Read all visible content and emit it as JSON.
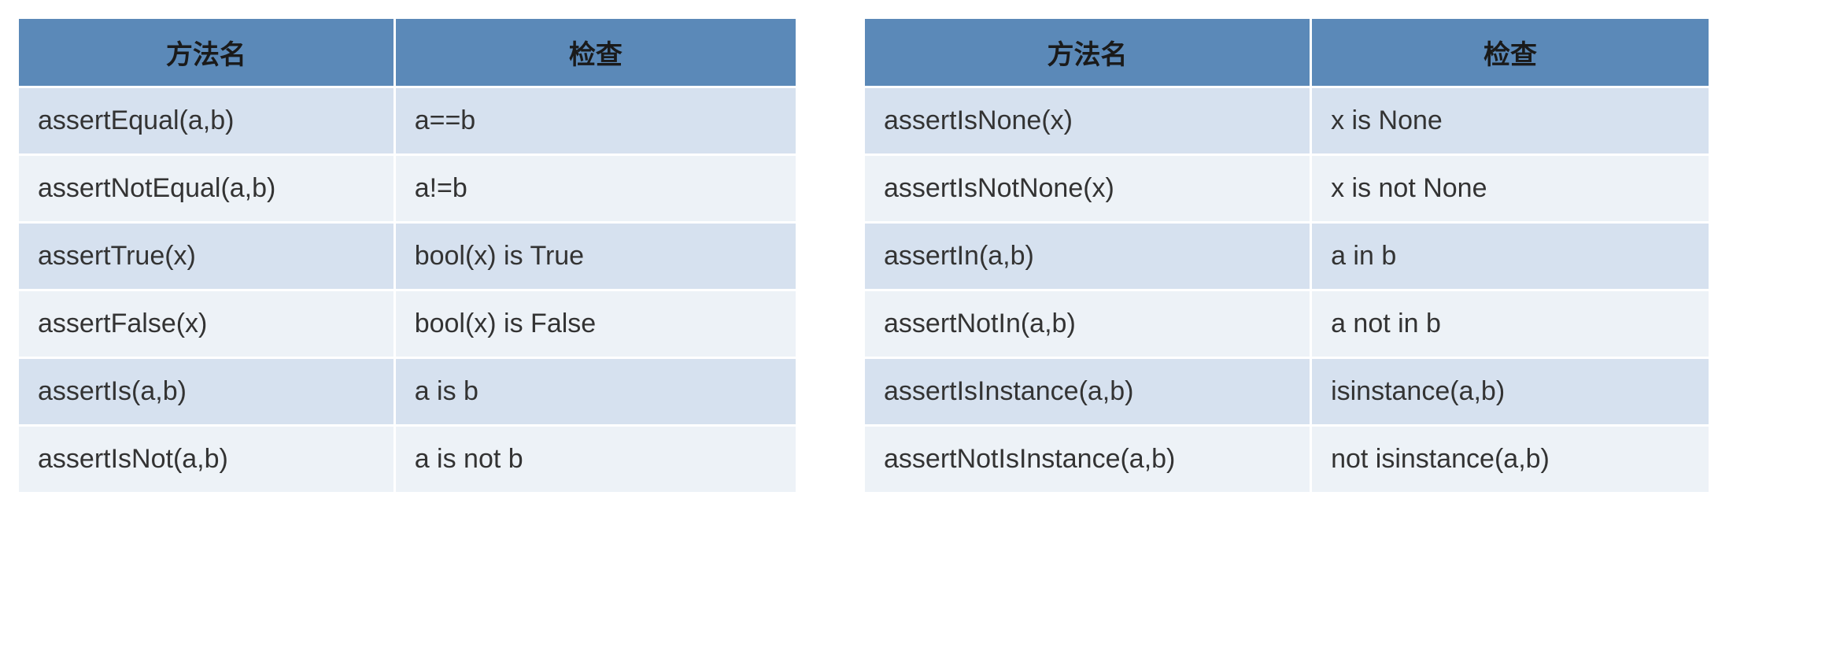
{
  "tables": [
    {
      "headers": [
        "方法名",
        "检查"
      ],
      "rows": [
        {
          "method": "assertEqual(a,b)",
          "check": "a==b"
        },
        {
          "method": "assertNotEqual(a,b)",
          "check": "a!=b"
        },
        {
          "method": "assertTrue(x)",
          "check": "bool(x) is True"
        },
        {
          "method": "assertFalse(x)",
          "check": "bool(x) is False"
        },
        {
          "method": "assertIs(a,b)",
          "check": "a is b"
        },
        {
          "method": "assertIsNot(a,b)",
          "check": "a is not b"
        }
      ]
    },
    {
      "headers": [
        "方法名",
        "检查"
      ],
      "rows": [
        {
          "method": "assertIsNone(x)",
          "check": "x is None"
        },
        {
          "method": "assertIsNotNone(x)",
          "check": "x is not None"
        },
        {
          "method": "assertIn(a,b)",
          "check": "a in b"
        },
        {
          "method": "assertNotIn(a,b)",
          "check": "a not in b"
        },
        {
          "method": "assertIsInstance(a,b)",
          "check": "isinstance(a,b)"
        },
        {
          "method": "assertNotIsInstance(a,b)",
          "check": "not isinstance(a,b)"
        }
      ]
    }
  ]
}
